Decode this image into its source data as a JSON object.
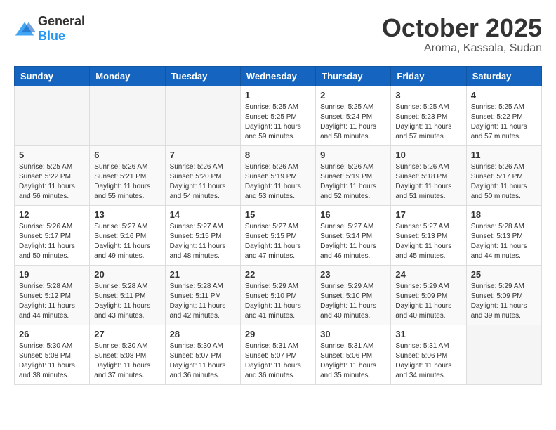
{
  "header": {
    "logo_general": "General",
    "logo_blue": "Blue",
    "title": "October 2025",
    "subtitle": "Aroma, Kassala, Sudan"
  },
  "days_of_week": [
    "Sunday",
    "Monday",
    "Tuesday",
    "Wednesday",
    "Thursday",
    "Friday",
    "Saturday"
  ],
  "weeks": [
    {
      "cells": [
        {
          "day": "",
          "info": ""
        },
        {
          "day": "",
          "info": ""
        },
        {
          "day": "",
          "info": ""
        },
        {
          "day": "1",
          "info": "Sunrise: 5:25 AM\nSunset: 5:25 PM\nDaylight: 11 hours\nand 59 minutes."
        },
        {
          "day": "2",
          "info": "Sunrise: 5:25 AM\nSunset: 5:24 PM\nDaylight: 11 hours\nand 58 minutes."
        },
        {
          "day": "3",
          "info": "Sunrise: 5:25 AM\nSunset: 5:23 PM\nDaylight: 11 hours\nand 57 minutes."
        },
        {
          "day": "4",
          "info": "Sunrise: 5:25 AM\nSunset: 5:22 PM\nDaylight: 11 hours\nand 57 minutes."
        }
      ]
    },
    {
      "cells": [
        {
          "day": "5",
          "info": "Sunrise: 5:25 AM\nSunset: 5:22 PM\nDaylight: 11 hours\nand 56 minutes."
        },
        {
          "day": "6",
          "info": "Sunrise: 5:26 AM\nSunset: 5:21 PM\nDaylight: 11 hours\nand 55 minutes."
        },
        {
          "day": "7",
          "info": "Sunrise: 5:26 AM\nSunset: 5:20 PM\nDaylight: 11 hours\nand 54 minutes."
        },
        {
          "day": "8",
          "info": "Sunrise: 5:26 AM\nSunset: 5:19 PM\nDaylight: 11 hours\nand 53 minutes."
        },
        {
          "day": "9",
          "info": "Sunrise: 5:26 AM\nSunset: 5:19 PM\nDaylight: 11 hours\nand 52 minutes."
        },
        {
          "day": "10",
          "info": "Sunrise: 5:26 AM\nSunset: 5:18 PM\nDaylight: 11 hours\nand 51 minutes."
        },
        {
          "day": "11",
          "info": "Sunrise: 5:26 AM\nSunset: 5:17 PM\nDaylight: 11 hours\nand 50 minutes."
        }
      ]
    },
    {
      "cells": [
        {
          "day": "12",
          "info": "Sunrise: 5:26 AM\nSunset: 5:17 PM\nDaylight: 11 hours\nand 50 minutes."
        },
        {
          "day": "13",
          "info": "Sunrise: 5:27 AM\nSunset: 5:16 PM\nDaylight: 11 hours\nand 49 minutes."
        },
        {
          "day": "14",
          "info": "Sunrise: 5:27 AM\nSunset: 5:15 PM\nDaylight: 11 hours\nand 48 minutes."
        },
        {
          "day": "15",
          "info": "Sunrise: 5:27 AM\nSunset: 5:15 PM\nDaylight: 11 hours\nand 47 minutes."
        },
        {
          "day": "16",
          "info": "Sunrise: 5:27 AM\nSunset: 5:14 PM\nDaylight: 11 hours\nand 46 minutes."
        },
        {
          "day": "17",
          "info": "Sunrise: 5:27 AM\nSunset: 5:13 PM\nDaylight: 11 hours\nand 45 minutes."
        },
        {
          "day": "18",
          "info": "Sunrise: 5:28 AM\nSunset: 5:13 PM\nDaylight: 11 hours\nand 44 minutes."
        }
      ]
    },
    {
      "cells": [
        {
          "day": "19",
          "info": "Sunrise: 5:28 AM\nSunset: 5:12 PM\nDaylight: 11 hours\nand 44 minutes."
        },
        {
          "day": "20",
          "info": "Sunrise: 5:28 AM\nSunset: 5:11 PM\nDaylight: 11 hours\nand 43 minutes."
        },
        {
          "day": "21",
          "info": "Sunrise: 5:28 AM\nSunset: 5:11 PM\nDaylight: 11 hours\nand 42 minutes."
        },
        {
          "day": "22",
          "info": "Sunrise: 5:29 AM\nSunset: 5:10 PM\nDaylight: 11 hours\nand 41 minutes."
        },
        {
          "day": "23",
          "info": "Sunrise: 5:29 AM\nSunset: 5:10 PM\nDaylight: 11 hours\nand 40 minutes."
        },
        {
          "day": "24",
          "info": "Sunrise: 5:29 AM\nSunset: 5:09 PM\nDaylight: 11 hours\nand 40 minutes."
        },
        {
          "day": "25",
          "info": "Sunrise: 5:29 AM\nSunset: 5:09 PM\nDaylight: 11 hours\nand 39 minutes."
        }
      ]
    },
    {
      "cells": [
        {
          "day": "26",
          "info": "Sunrise: 5:30 AM\nSunset: 5:08 PM\nDaylight: 11 hours\nand 38 minutes."
        },
        {
          "day": "27",
          "info": "Sunrise: 5:30 AM\nSunset: 5:08 PM\nDaylight: 11 hours\nand 37 minutes."
        },
        {
          "day": "28",
          "info": "Sunrise: 5:30 AM\nSunset: 5:07 PM\nDaylight: 11 hours\nand 36 minutes."
        },
        {
          "day": "29",
          "info": "Sunrise: 5:31 AM\nSunset: 5:07 PM\nDaylight: 11 hours\nand 36 minutes."
        },
        {
          "day": "30",
          "info": "Sunrise: 5:31 AM\nSunset: 5:06 PM\nDaylight: 11 hours\nand 35 minutes."
        },
        {
          "day": "31",
          "info": "Sunrise: 5:31 AM\nSunset: 5:06 PM\nDaylight: 11 hours\nand 34 minutes."
        },
        {
          "day": "",
          "info": ""
        }
      ]
    }
  ]
}
